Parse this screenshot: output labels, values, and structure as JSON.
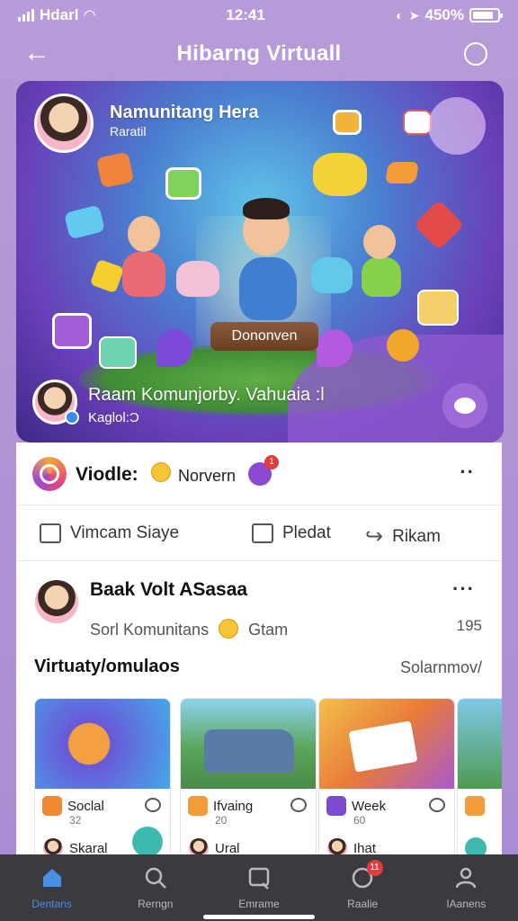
{
  "status_bar": {
    "carrier": "Hdarl",
    "time": "12:41",
    "battery_text": "450%"
  },
  "header": {
    "title": "Hibarng Virtuall"
  },
  "hero": {
    "title": "Namunitang Hera",
    "subtitle": "Raratil",
    "tag": "Dononven",
    "footer_title": "Raam Komunjorby. Vahuaia :l",
    "footer_sub": "Kaglol:Ɔ"
  },
  "feed_header": {
    "title": "Viodle:",
    "label": "Norvern"
  },
  "actions": [
    {
      "label": "Vimcam Siaye"
    },
    {
      "label": "Pledat"
    },
    {
      "label": "Rikam"
    }
  ],
  "post": {
    "title": "Baak Volt ASasaa",
    "sub_left": "Sorl Komunitans",
    "sub_right": "Gtam",
    "count": "195"
  },
  "section": {
    "title": "Virtuaty/omulaos",
    "link": "Solarnmov/"
  },
  "tiles": [
    {
      "title": "Soclal",
      "meta": "32",
      "extra": "Skaral"
    },
    {
      "title": "Ifvaing",
      "meta": "20",
      "extra": "Ural"
    },
    {
      "title": "Week",
      "meta": "60",
      "extra": "Ihat"
    },
    {
      "title": "",
      "meta": "",
      "extra": ""
    }
  ],
  "bottom_nav": [
    {
      "label": "Dentans",
      "active": true
    },
    {
      "label": "Rerngn",
      "active": false
    },
    {
      "label": "Emrame",
      "active": false
    },
    {
      "label": "Raalie",
      "active": false,
      "badge": "11"
    },
    {
      "label": "IAanens",
      "active": false
    }
  ],
  "colors": {
    "accent": "#4a90e2",
    "purple": "#8a4ad0",
    "nav_bg": "#3a3a40"
  }
}
